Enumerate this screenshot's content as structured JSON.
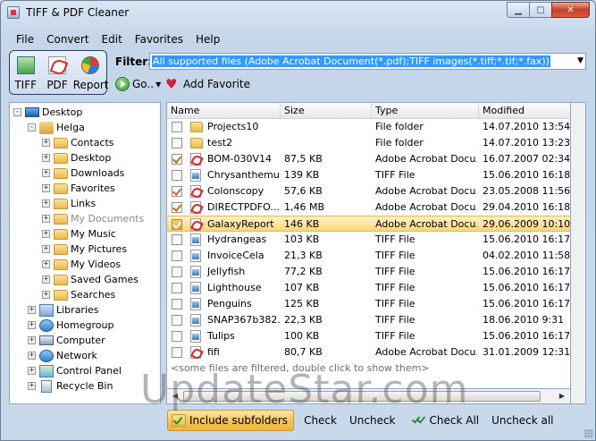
{
  "window": {
    "title": "TIFF & PDF Cleaner"
  },
  "menu": {
    "items": [
      "File",
      "Convert",
      "Edit",
      "Favorites",
      "Help"
    ]
  },
  "toolbar": {
    "tiff_label": "TIFF",
    "pdf_label": "PDF",
    "report_label": "Report",
    "filter_label": "Filter:",
    "filter_value": "All supported files (Adobe Acrobat Document(*.pdf);TIFF images(*.tiff;*.tif;*.fax))",
    "go_label": "Go..",
    "add_favorite_label": "Add Favorite"
  },
  "tree": {
    "items": [
      {
        "label": "Desktop",
        "icon": "desktop-icon",
        "level": 0,
        "expander": "-"
      },
      {
        "label": "Helga",
        "icon": "user-folder-icon",
        "level": 1,
        "expander": "-"
      },
      {
        "label": "Contacts",
        "icon": "folder-icon",
        "level": 2,
        "expander": "+"
      },
      {
        "label": "Desktop",
        "icon": "folder-icon",
        "level": 2,
        "expander": "+"
      },
      {
        "label": "Downloads",
        "icon": "folder-icon",
        "level": 2,
        "expander": "+"
      },
      {
        "label": "Favorites",
        "icon": "folder-icon",
        "level": 2,
        "expander": "+"
      },
      {
        "label": "Links",
        "icon": "folder-icon",
        "level": 2,
        "expander": "+"
      },
      {
        "label": "My Documents",
        "icon": "folder-icon",
        "level": 2,
        "expander": "+",
        "dim": true
      },
      {
        "label": "My Music",
        "icon": "folder-icon",
        "level": 2,
        "expander": "+"
      },
      {
        "label": "My Pictures",
        "icon": "folder-icon",
        "level": 2,
        "expander": "+"
      },
      {
        "label": "My Videos",
        "icon": "folder-icon",
        "level": 2,
        "expander": "+"
      },
      {
        "label": "Saved Games",
        "icon": "folder-icon",
        "level": 2,
        "expander": "+"
      },
      {
        "label": "Searches",
        "icon": "folder-icon",
        "level": 2,
        "expander": "+"
      },
      {
        "label": "Libraries",
        "icon": "library-icon",
        "level": 1,
        "expander": "+"
      },
      {
        "label": "Homegroup",
        "icon": "homegroup-icon",
        "level": 1,
        "expander": "+"
      },
      {
        "label": "Computer",
        "icon": "computer-icon",
        "level": 1,
        "expander": "+"
      },
      {
        "label": "Network",
        "icon": "network-icon",
        "level": 1,
        "expander": "+"
      },
      {
        "label": "Control Panel",
        "icon": "control-panel-icon",
        "level": 1,
        "expander": "+"
      },
      {
        "label": "Recycle Bin",
        "icon": "recycle-bin-icon",
        "level": 1,
        "expander": "+"
      }
    ]
  },
  "list": {
    "columns": [
      "Name",
      "Size",
      "Type",
      "Modified"
    ],
    "rows": [
      {
        "checked": false,
        "icon": "folder",
        "name": "Projects10",
        "size": "",
        "type": "File folder",
        "modified": "14.07.2010 13:54"
      },
      {
        "checked": false,
        "icon": "folder",
        "name": "test2",
        "size": "",
        "type": "File folder",
        "modified": "14.07.2010 13:23"
      },
      {
        "checked": true,
        "icon": "pdf",
        "name": "BOM-030V14",
        "size": "87,5 KB",
        "type": "Adobe Acrobat Docu...",
        "modified": "16.07.2007 02:34"
      },
      {
        "checked": false,
        "icon": "tiff",
        "name": "Chrysanthemum",
        "size": "139 KB",
        "type": "TIFF File",
        "modified": "15.06.2010 16:18"
      },
      {
        "checked": true,
        "icon": "pdf",
        "name": "Colonscopy",
        "size": "57,6 KB",
        "type": "Adobe Acrobat Docu...",
        "modified": "23.05.2008 11:56"
      },
      {
        "checked": true,
        "icon": "pdf",
        "name": "DIRECTPDFO...",
        "size": "1,46 MB",
        "type": "Adobe Acrobat Docu...",
        "modified": "29.04.2010 16:18"
      },
      {
        "checked": true,
        "icon": "pdf",
        "name": "GalaxyReport",
        "size": "146 KB",
        "type": "Adobe Acrobat Docu...",
        "modified": "29.06.2009 10:10",
        "selected": true
      },
      {
        "checked": false,
        "icon": "tiff",
        "name": "Hydrangeas",
        "size": "103 KB",
        "type": "TIFF File",
        "modified": "15.06.2010 16:17"
      },
      {
        "checked": false,
        "icon": "tiff",
        "name": "InvoiceCela",
        "size": "21,3 KB",
        "type": "TIFF File",
        "modified": "04.02.2010 11:58"
      },
      {
        "checked": false,
        "icon": "tiff",
        "name": "Jellyfish",
        "size": "77,2 KB",
        "type": "TIFF File",
        "modified": "15.06.2010 16:17"
      },
      {
        "checked": false,
        "icon": "tiff",
        "name": "Lighthouse",
        "size": "107 KB",
        "type": "TIFF File",
        "modified": "15.06.2010 16:17"
      },
      {
        "checked": false,
        "icon": "tiff",
        "name": "Penguins",
        "size": "125 KB",
        "type": "TIFF File",
        "modified": "15.06.2010 16:17"
      },
      {
        "checked": false,
        "icon": "tiff",
        "name": "SNAP367b382...",
        "size": "22,3 KB",
        "type": "TIFF File",
        "modified": "18.06.2010 9:31"
      },
      {
        "checked": false,
        "icon": "tiff",
        "name": "Tulips",
        "size": "100 KB",
        "type": "TIFF File",
        "modified": "15.06.2010 16:17"
      },
      {
        "checked": false,
        "icon": "pdf",
        "name": "fifi",
        "size": "80,7 KB",
        "type": "Adobe Acrobat Docu...",
        "modified": "31.01.2009 12:31"
      }
    ],
    "note": "<some files are filtered, double click to show them>"
  },
  "bottom": {
    "include_subfolders": "Include subfolders",
    "check": "Check",
    "uncheck": "Uncheck",
    "check_all": "Check All",
    "uncheck_all": "Uncheck all"
  },
  "watermark": "UpdateStar.com"
}
